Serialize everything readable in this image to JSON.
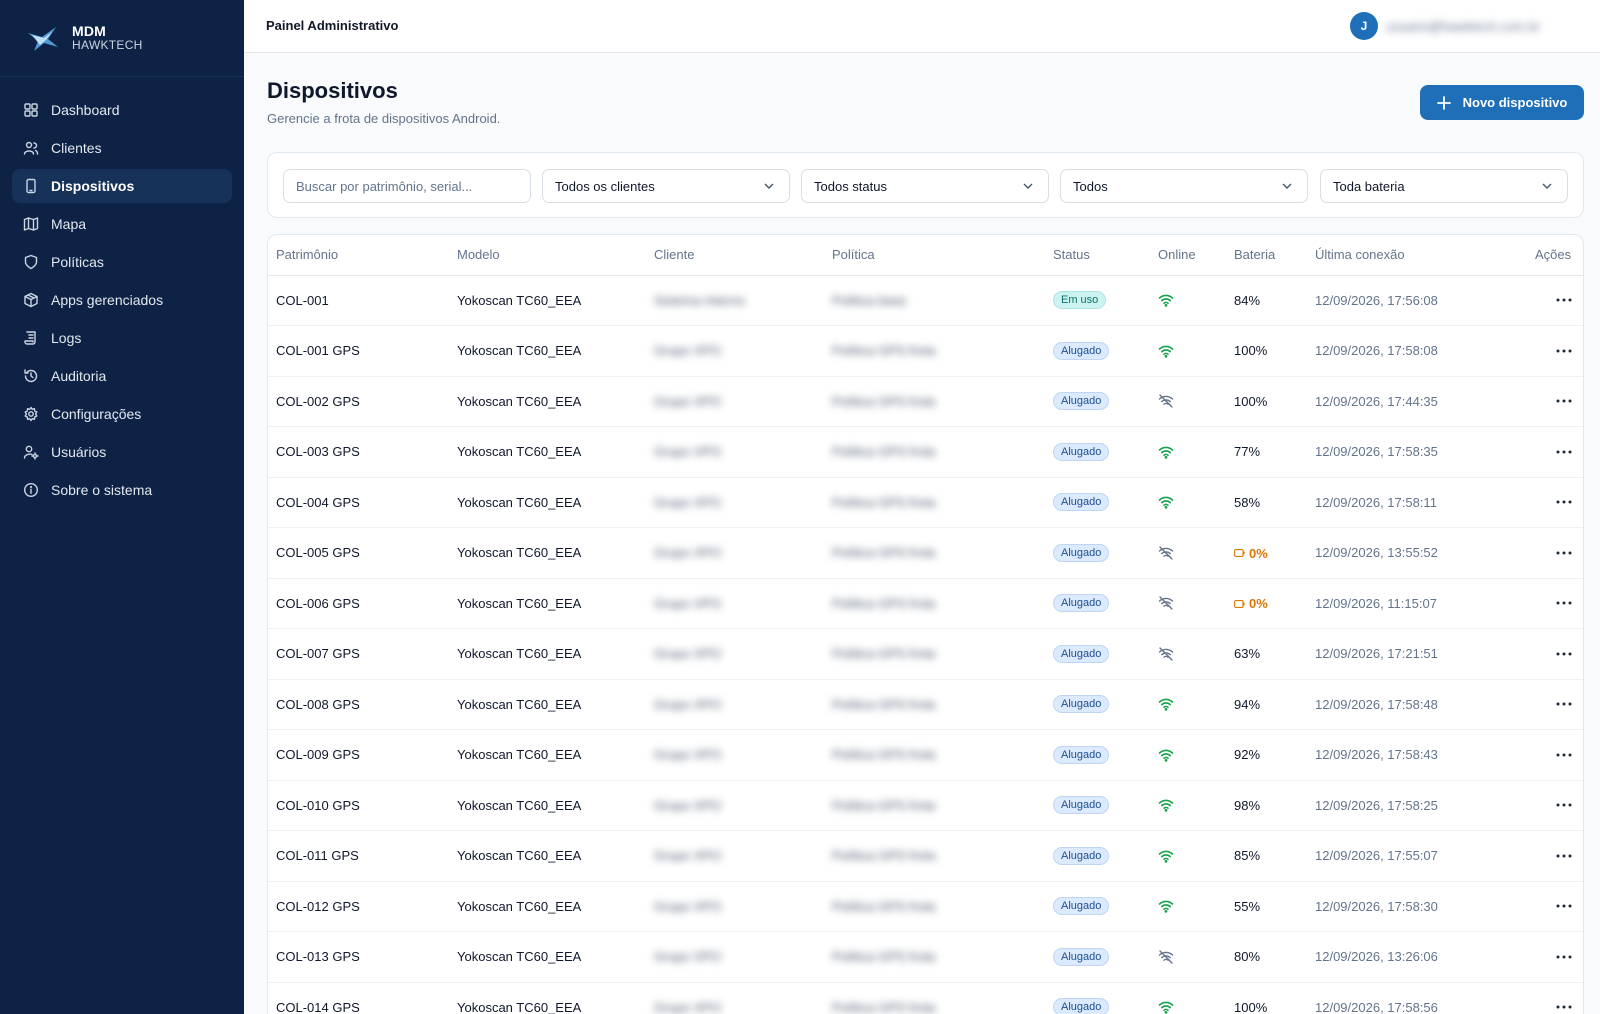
{
  "brand": {
    "title": "MDM",
    "subtitle": "HAWKTECH"
  },
  "sidebar": {
    "items": [
      {
        "label": "Dashboard",
        "icon": "dashboard-icon"
      },
      {
        "label": "Clientes",
        "icon": "users-icon"
      },
      {
        "label": "Dispositivos",
        "icon": "smartphone-icon",
        "active": true
      },
      {
        "label": "Mapa",
        "icon": "map-icon"
      },
      {
        "label": "Políticas",
        "icon": "shield-icon"
      },
      {
        "label": "Apps gerenciados",
        "icon": "package-icon"
      },
      {
        "label": "Logs",
        "icon": "scroll-icon"
      },
      {
        "label": "Auditoria",
        "icon": "history-icon"
      },
      {
        "label": "Configurações",
        "icon": "gear-icon"
      },
      {
        "label": "Usuários",
        "icon": "user-cog-icon"
      },
      {
        "label": "Sobre o sistema",
        "icon": "info-icon"
      }
    ]
  },
  "header": {
    "title": "Painel Administrativo",
    "avatar_initial": "J",
    "user_email": "usuario@hawktech.com.br"
  },
  "page": {
    "title": "Dispositivos",
    "subtitle": "Gerencie a frota de dispositivos Android.",
    "new_button": "Novo dispositivo"
  },
  "filters": {
    "search_placeholder": "Buscar por patrimônio, serial...",
    "client": "Todos os clientes",
    "status": "Todos status",
    "online": "Todos",
    "battery": "Toda bateria"
  },
  "table": {
    "columns": [
      "Patrimônio",
      "Modelo",
      "Cliente",
      "Política",
      "Status",
      "Online",
      "Bateria",
      "Última conexão",
      "Ações"
    ],
    "rows": [
      {
        "patrimonio": "COL-001",
        "modelo": "Yokoscan TC60_EEA",
        "cliente": "Sistema Interno",
        "politica": "Política base",
        "status": "Em uso",
        "status_kind": "emuso",
        "online": true,
        "bateria": "84%",
        "bateria_low": false,
        "ultima": "12/09/2026, 17:56:08"
      },
      {
        "patrimonio": "COL-001 GPS",
        "modelo": "Yokoscan TC60_EEA",
        "cliente": "Grupo XPO",
        "politica": "Política GPS frota",
        "status": "Alugado",
        "status_kind": "alugado",
        "online": true,
        "bateria": "100%",
        "bateria_low": false,
        "ultima": "12/09/2026, 17:58:08"
      },
      {
        "patrimonio": "COL-002 GPS",
        "modelo": "Yokoscan TC60_EEA",
        "cliente": "Grupo XPO",
        "politica": "Política GPS frota",
        "status": "Alugado",
        "status_kind": "alugado",
        "online": false,
        "bateria": "100%",
        "bateria_low": false,
        "ultima": "12/09/2026, 17:44:35"
      },
      {
        "patrimonio": "COL-003 GPS",
        "modelo": "Yokoscan TC60_EEA",
        "cliente": "Grupo XPO",
        "politica": "Política GPS frota",
        "status": "Alugado",
        "status_kind": "alugado",
        "online": true,
        "bateria": "77%",
        "bateria_low": false,
        "ultima": "12/09/2026, 17:58:35"
      },
      {
        "patrimonio": "COL-004 GPS",
        "modelo": "Yokoscan TC60_EEA",
        "cliente": "Grupo XPO",
        "politica": "Política GPS frota",
        "status": "Alugado",
        "status_kind": "alugado",
        "online": true,
        "bateria": "58%",
        "bateria_low": false,
        "ultima": "12/09/2026, 17:58:11"
      },
      {
        "patrimonio": "COL-005 GPS",
        "modelo": "Yokoscan TC60_EEA",
        "cliente": "Grupo XPO",
        "politica": "Política GPS frota",
        "status": "Alugado",
        "status_kind": "alugado",
        "online": false,
        "bateria": "0%",
        "bateria_low": true,
        "ultima": "12/09/2026, 13:55:52"
      },
      {
        "patrimonio": "COL-006 GPS",
        "modelo": "Yokoscan TC60_EEA",
        "cliente": "Grupo XPO",
        "politica": "Política GPS frota",
        "status": "Alugado",
        "status_kind": "alugado",
        "online": false,
        "bateria": "0%",
        "bateria_low": true,
        "ultima": "12/09/2026, 11:15:07"
      },
      {
        "patrimonio": "COL-007 GPS",
        "modelo": "Yokoscan TC60_EEA",
        "cliente": "Grupo XPO",
        "politica": "Política GPS frota",
        "status": "Alugado",
        "status_kind": "alugado",
        "online": false,
        "bateria": "63%",
        "bateria_low": false,
        "ultima": "12/09/2026, 17:21:51"
      },
      {
        "patrimonio": "COL-008 GPS",
        "modelo": "Yokoscan TC60_EEA",
        "cliente": "Grupo XPO",
        "politica": "Política GPS frota",
        "status": "Alugado",
        "status_kind": "alugado",
        "online": true,
        "bateria": "94%",
        "bateria_low": false,
        "ultima": "12/09/2026, 17:58:48"
      },
      {
        "patrimonio": "COL-009 GPS",
        "modelo": "Yokoscan TC60_EEA",
        "cliente": "Grupo XPO",
        "politica": "Política GPS frota",
        "status": "Alugado",
        "status_kind": "alugado",
        "online": true,
        "bateria": "92%",
        "bateria_low": false,
        "ultima": "12/09/2026, 17:58:43"
      },
      {
        "patrimonio": "COL-010 GPS",
        "modelo": "Yokoscan TC60_EEA",
        "cliente": "Grupo XPO",
        "politica": "Política GPS frota",
        "status": "Alugado",
        "status_kind": "alugado",
        "online": true,
        "bateria": "98%",
        "bateria_low": false,
        "ultima": "12/09/2026, 17:58:25"
      },
      {
        "patrimonio": "COL-011 GPS",
        "modelo": "Yokoscan TC60_EEA",
        "cliente": "Grupo XPO",
        "politica": "Política GPS frota",
        "status": "Alugado",
        "status_kind": "alugado",
        "online": true,
        "bateria": "85%",
        "bateria_low": false,
        "ultima": "12/09/2026, 17:55:07"
      },
      {
        "patrimonio": "COL-012 GPS",
        "modelo": "Yokoscan TC60_EEA",
        "cliente": "Grupo XPO",
        "politica": "Política GPS frota",
        "status": "Alugado",
        "status_kind": "alugado",
        "online": true,
        "bateria": "55%",
        "bateria_low": false,
        "ultima": "12/09/2026, 17:58:30"
      },
      {
        "patrimonio": "COL-013 GPS",
        "modelo": "Yokoscan TC60_EEA",
        "cliente": "Grupo XPO",
        "politica": "Política GPS frota",
        "status": "Alugado",
        "status_kind": "alugado",
        "online": false,
        "bateria": "80%",
        "bateria_low": false,
        "ultima": "12/09/2026, 13:26:06"
      },
      {
        "patrimonio": "COL-014 GPS",
        "modelo": "Yokoscan TC60_EEA",
        "cliente": "Grupo XPO",
        "politica": "Política GPS frota",
        "status": "Alugado",
        "status_kind": "alugado",
        "online": true,
        "bateria": "100%",
        "bateria_low": false,
        "ultima": "12/09/2026, 17:58:56"
      }
    ]
  },
  "colors": {
    "sidebar": "#0d2244",
    "accent": "#1e6fb8",
    "online": "#16a34a",
    "warning": "#d97706"
  }
}
